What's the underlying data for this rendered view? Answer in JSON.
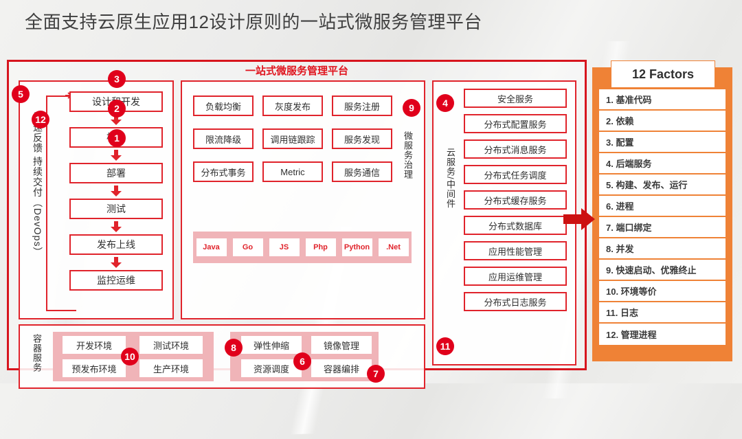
{
  "page_title": "全面支持云原生应用12设计原则的一站式微服务管理平台",
  "platform": {
    "title": "一站式微服务管理平台",
    "devops": {
      "label": "快速反馈 持续交付（DevOps）",
      "steps": [
        "设计和开发",
        "构建",
        "部署",
        "测试",
        "发布上线",
        "监控运维"
      ],
      "badges": [
        "5",
        "12",
        "3",
        "2",
        "1"
      ]
    },
    "microservice": {
      "side_label": "微服务治理",
      "badge": "9",
      "rows": [
        [
          "负载均衡",
          "灰度发布",
          "服务注册"
        ],
        [
          "限流降级",
          "调用链跟踪",
          "服务发现"
        ],
        [
          "分布式事务",
          "Metric",
          "服务通信"
        ]
      ],
      "languages": [
        "Java",
        "Go",
        "JS",
        "Php",
        "Python",
        ".Net"
      ]
    },
    "cloud": {
      "side_label": "云服务/中间件",
      "badge_top": "4",
      "badge_bottom": "11",
      "items": [
        "安全服务",
        "分布式配置服务",
        "分布式消息服务",
        "分布式任务调度",
        "分布式缓存服务",
        "分布式数据库",
        "应用性能管理",
        "应用运维管理",
        "分布式日志服务"
      ]
    },
    "container": {
      "side_label": "容器服务",
      "environments": [
        "开发环境",
        "测试环境",
        "预发布环境",
        "生产环境"
      ],
      "env_badge": "10",
      "operations": [
        "弹性伸缩",
        "镜像管理",
        "资源调度",
        "容器编排"
      ],
      "op_badges": [
        "8",
        "6",
        "7"
      ]
    }
  },
  "factors": {
    "header": "12 Factors",
    "items": [
      "1. 基准代码",
      "2. 依赖",
      "3. 配置",
      "4. 后端服务",
      "5. 构建、发布、运行",
      "6. 进程",
      "7. 端口绑定",
      "8. 并发",
      "9. 快速启动、优雅终止",
      "10. 环境等价",
      "11. 日志",
      "12. 管理进程"
    ]
  },
  "colors": {
    "red": "#e0232b",
    "badge_red": "#e0001b",
    "pink": "#f0b4b8",
    "orange": "#ef8236"
  }
}
